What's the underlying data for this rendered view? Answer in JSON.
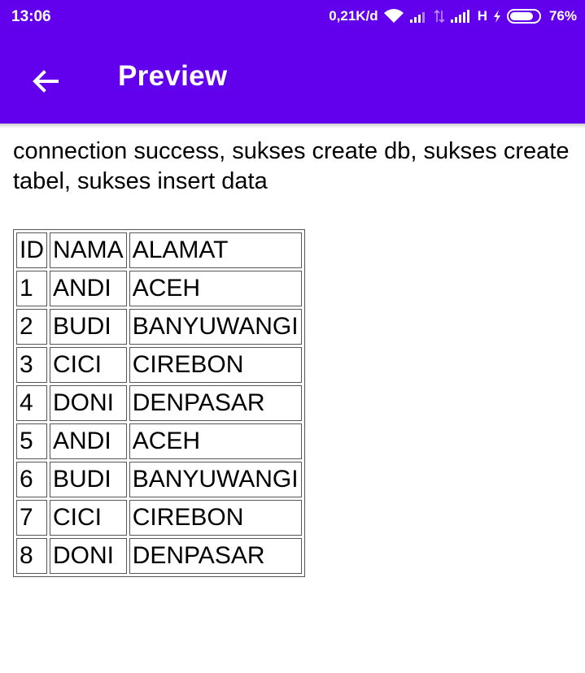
{
  "status_bar": {
    "time": "13:06",
    "network_speed": "0,21K/d",
    "network_type": "H",
    "battery": "76%",
    "icons": [
      "wifi-icon",
      "signal-icon",
      "data-transfer-icon",
      "signal-icon",
      "charging-icon",
      "battery-icon"
    ]
  },
  "app_bar": {
    "title": "Preview",
    "back_icon": "arrow-back-icon",
    "color": "#6200ee"
  },
  "message": "connection success, sukses create db, sukses create tabel, sukses insert data",
  "table": {
    "headers": [
      "ID",
      "NAMA",
      "ALAMAT"
    ],
    "rows": [
      [
        "1",
        "ANDI",
        "ACEH"
      ],
      [
        "2",
        "BUDI",
        "BANYUWANGI"
      ],
      [
        "3",
        "CICI",
        "CIREBON"
      ],
      [
        "4",
        "DONI",
        "DENPASAR"
      ],
      [
        "5",
        "ANDI",
        "ACEH"
      ],
      [
        "6",
        "BUDI",
        "BANYUWANGI"
      ],
      [
        "7",
        "CICI",
        "CIREBON"
      ],
      [
        "8",
        "DONI",
        "DENPASAR"
      ]
    ]
  }
}
